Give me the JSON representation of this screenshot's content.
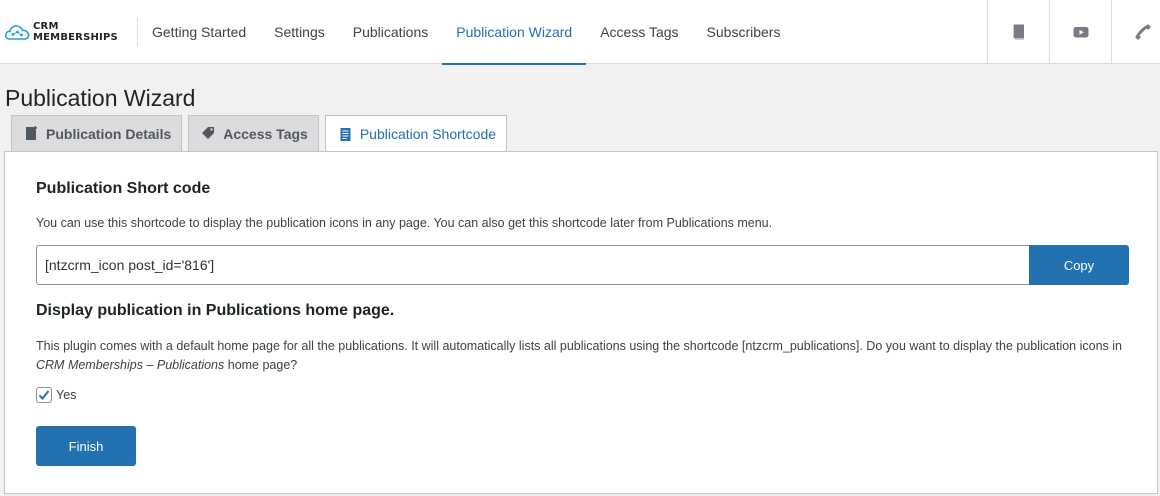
{
  "logo": {
    "line1": "CRM",
    "line2": "MEMBERSHIPS",
    "icon": "cloud-network-icon"
  },
  "nav": {
    "items": [
      {
        "label": "Getting Started"
      },
      {
        "label": "Settings"
      },
      {
        "label": "Publications"
      },
      {
        "label": "Publication Wizard",
        "active": true
      },
      {
        "label": "Access Tags"
      },
      {
        "label": "Subscribers"
      }
    ],
    "icons": [
      "book-icon",
      "youtube-icon",
      "phone-icon"
    ]
  },
  "page": {
    "title": "Publication Wizard"
  },
  "tabs": [
    {
      "label": "Publication Details",
      "icon": "document-plus-icon"
    },
    {
      "label": "Access Tags",
      "icon": "tag-icon"
    },
    {
      "label": "Publication Shortcode",
      "icon": "document-text-icon",
      "active": true
    }
  ],
  "shortcode": {
    "heading": "Publication Short code",
    "description": "You can use this shortcode to display the publication icons in any page. You can also get this shortcode later from Publications menu.",
    "value": "[ntzcrm_icon post_id='816']",
    "copy_label": "Copy"
  },
  "home_display": {
    "heading": "Display publication in Publications home page.",
    "description_before": "This plugin comes with a default home page for all the publications. It will automatically lists all publications using the shortcode [ntzcrm_publications]. Do you want to display the publication icons in ",
    "description_em": "CRM Memberships – Publications",
    "description_after": " home page?",
    "checkbox_label": "Yes",
    "checked": true
  },
  "finish_label": "Finish",
  "colors": {
    "accent": "#2271b1",
    "background": "#f1f1f1",
    "tab_inactive": "#dcdcde"
  }
}
